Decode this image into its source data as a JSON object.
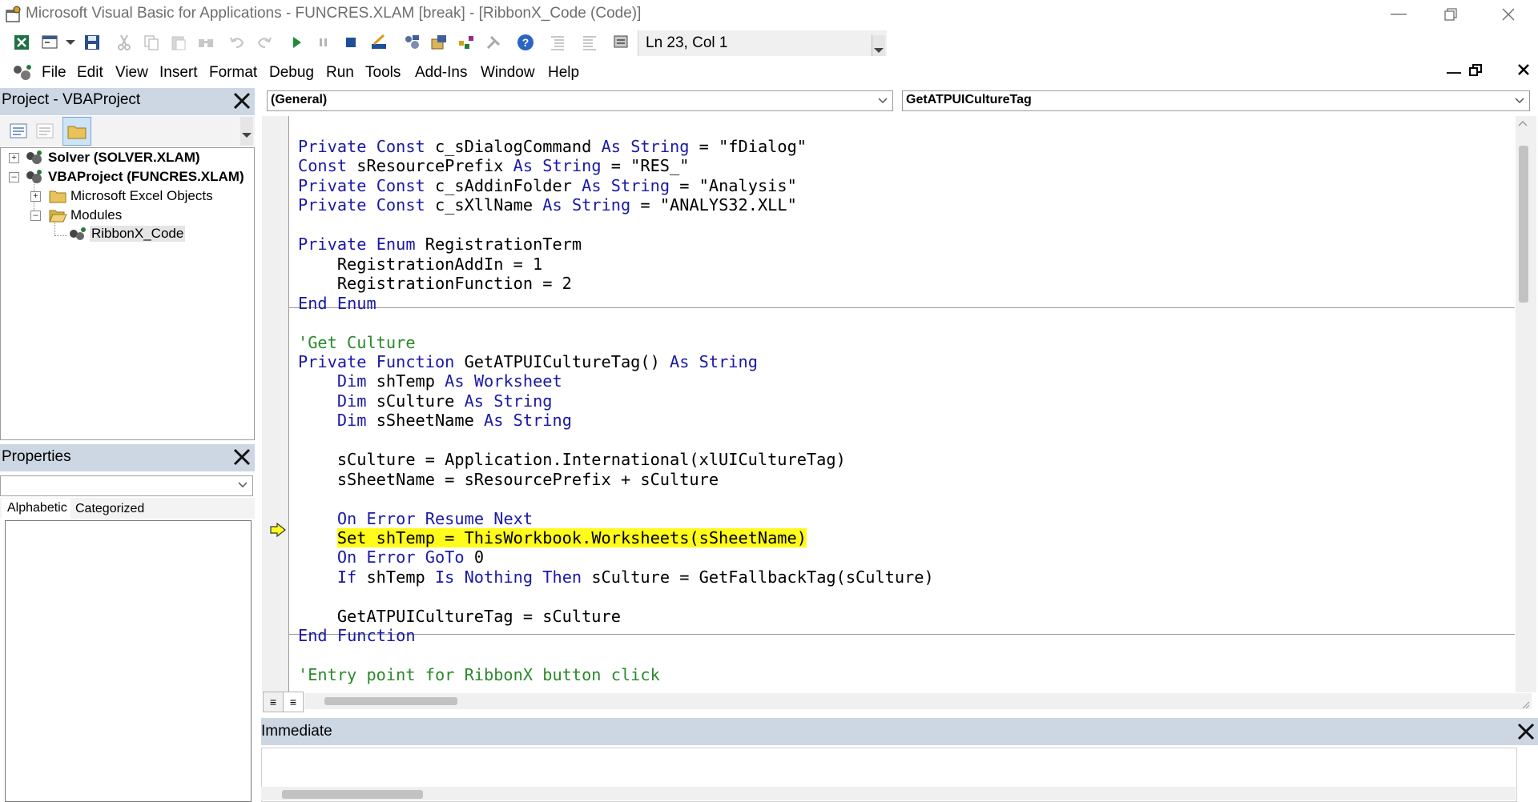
{
  "window": {
    "title": "Microsoft Visual Basic for Applications - FUNCRES.XLAM [break] - [RibbonX_Code (Code)]",
    "minimize_icon": "minimize-icon",
    "restore_icon": "restore-icon",
    "close_icon": "close-icon"
  },
  "toolbar": {
    "position_text": "Ln 23, Col 1",
    "icons": [
      "excel-icon",
      "insert-userform-icon",
      "save-icon",
      "cut-icon",
      "copy-icon",
      "paste-icon",
      "find-icon",
      "undo-icon",
      "redo-icon",
      "run-icon",
      "break-icon",
      "reset-icon",
      "design-mode-icon",
      "project-explorer-icon",
      "properties-window-icon",
      "object-browser-icon",
      "toolbox-icon",
      "help-icon",
      "indent-icon",
      "outdent-icon",
      "toolbar-options-icon"
    ]
  },
  "menu": {
    "items": [
      "File",
      "Edit",
      "View",
      "Insert",
      "Format",
      "Debug",
      "Run",
      "Tools",
      "Add-Ins",
      "Window",
      "Help"
    ]
  },
  "project": {
    "title": "Project - VBAProject",
    "tree": [
      {
        "label": "Solver (SOLVER.XLAM)",
        "bold": true
      },
      {
        "label": "VBAProject (FUNCRES.XLAM)",
        "bold": true
      },
      {
        "label": "Microsoft Excel Objects",
        "bold": false
      },
      {
        "label": "Modules",
        "bold": false
      },
      {
        "label": "RibbonX_Code",
        "bold": false
      }
    ]
  },
  "properties": {
    "title": "Properties",
    "tabs": [
      "Alphabetic",
      "Categorized"
    ],
    "selected_object": ""
  },
  "code": {
    "object_combo": "(General)",
    "procedure_combo": "GetATPUICultureTag",
    "current_line": "Set shTemp = ThisWorkbook.Worksheets(sSheetName)",
    "lines": [
      "Private Const c_sDialogCommand As String = \"fDialog\"",
      "Const sResourcePrefix As String = \"RES_\"",
      "Private Const c_sAddinFolder As String = \"Analysis\"",
      "Private Const c_sXllName As String = \"ANALYS32.XLL\"",
      "",
      "Private Enum RegistrationTerm",
      "    RegistrationAddIn = 1",
      "    RegistrationFunction = 2",
      "End Enum",
      "",
      "'Get Culture",
      "Private Function GetATPUICultureTag() As String",
      "    Dim shTemp As Worksheet",
      "    Dim sCulture As String",
      "    Dim sSheetName As String",
      "",
      "    sCulture = Application.International(xlUICultureTag)",
      "    sSheetName = sResourcePrefix + sCulture",
      "",
      "    On Error Resume Next",
      "    Set shTemp = ThisWorkbook.Worksheets(sSheetName)",
      "    On Error GoTo 0",
      "    If shTemp Is Nothing Then sCulture = GetFallbackTag(sCulture)",
      "",
      "    GetATPUICultureTag = sCulture",
      "End Function",
      "",
      "'Entry point for RibbonX button click"
    ]
  },
  "immediate": {
    "title": "Immediate",
    "content": ""
  },
  "colors": {
    "keyword": "#1a1aa6",
    "comment": "#2a8a2a",
    "execution_highlight": "#fffb1a",
    "pane_header": "#ccd7e3"
  }
}
